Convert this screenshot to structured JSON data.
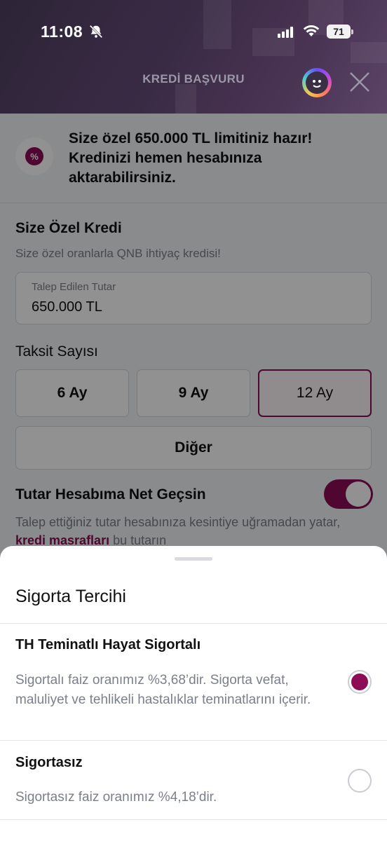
{
  "status_bar": {
    "time": "11:08",
    "battery": "71"
  },
  "header": {
    "title": "KREDİ BAŞVURU"
  },
  "promo": {
    "text": "Size özel 650.000 TL limitiniz hazır! Kredinizi hemen hesabınıza aktarabilirsiniz.",
    "badge": "%"
  },
  "loan": {
    "title": "Size Özel Kredi",
    "subtitle": "Size özel oranlarla QNB ihtiyaç kredisi!",
    "amount_label": "Talep Edilen Tutar",
    "amount_value": "650.000 TL"
  },
  "installments": {
    "title": "Taksit Sayısı",
    "options": [
      "6 Ay",
      "9 Ay",
      "12 Ay"
    ],
    "selected": "12 Ay",
    "other": "Diğer"
  },
  "net_transfer": {
    "title": "Tutar Hesabıma Net Geçsin",
    "enabled": true,
    "desc_before": "Talep ettiğiniz tutar hesabınıza kesintiye uğramadan yatar, ",
    "desc_link": "kredi masrafları",
    "desc_after": " bu tutarın"
  },
  "sheet": {
    "title": "Sigorta Tercihi",
    "options": [
      {
        "title": "TH Teminatlı Hayat Sigortalı",
        "desc": "Sigortalı faiz oranımız %3,68’dir. Sigorta vefat, maluliyet ve tehlikeli hastalıklar teminatlarını içerir.",
        "selected": true
      },
      {
        "title": "Sigortasız",
        "desc": "Sigortasız faiz oranımız %4,18’dir.",
        "selected": false
      }
    ]
  },
  "colors": {
    "accent": "#8c0c55",
    "header_bg": "#3a2b45",
    "muted_text": "#7b7f8a"
  }
}
